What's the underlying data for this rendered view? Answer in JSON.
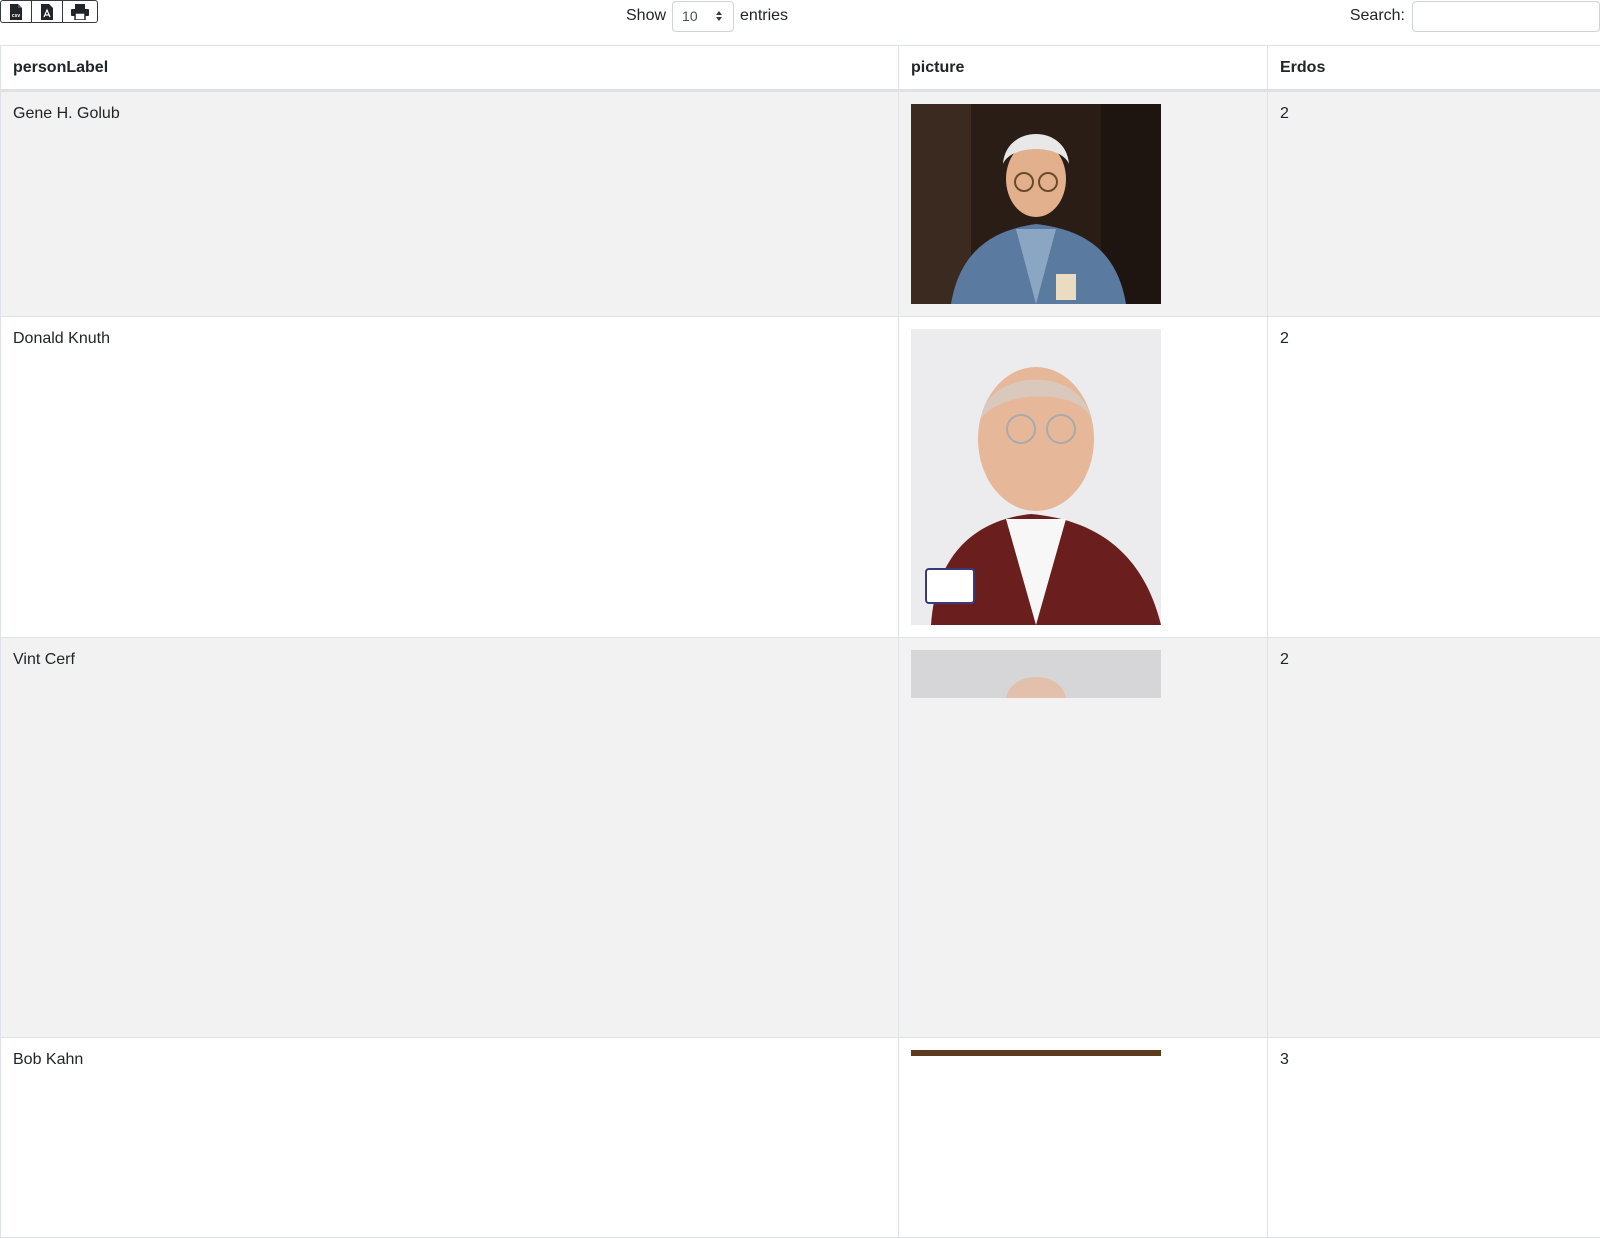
{
  "export_buttons": [
    {
      "name": "csv-export-icon"
    },
    {
      "name": "pdf-export-icon"
    },
    {
      "name": "print-icon"
    }
  ],
  "length_menu": {
    "show_label": "Show",
    "value": "10",
    "entries_label": "entries"
  },
  "search": {
    "label": "Search:",
    "value": "",
    "placeholder": ""
  },
  "table": {
    "columns": [
      "personLabel",
      "picture",
      "Erdos"
    ],
    "rows": [
      {
        "personLabel": "Gene H. Golub",
        "Erdos": "2"
      },
      {
        "personLabel": "Donald Knuth",
        "Erdos": "2"
      },
      {
        "personLabel": "Vint Cerf",
        "Erdos": "2"
      },
      {
        "personLabel": "Bob Kahn",
        "Erdos": "3"
      }
    ]
  }
}
